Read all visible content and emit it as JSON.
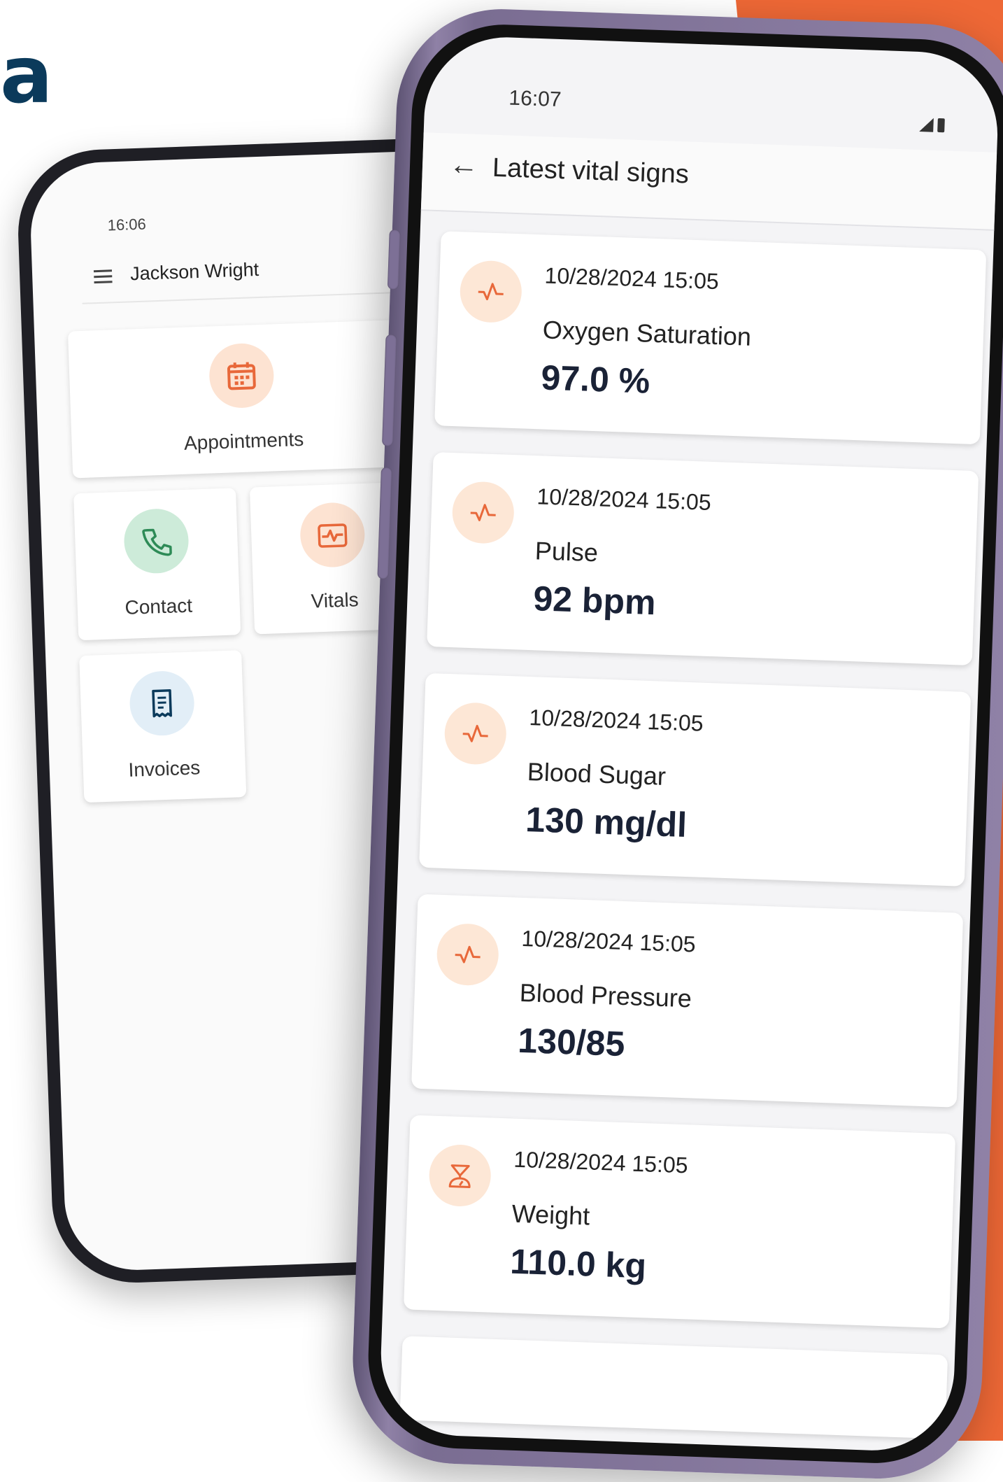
{
  "brand": {
    "letter": "a",
    "text_color": "#0b3a5b",
    "accent_color": "#ee6836"
  },
  "back_phone": {
    "status_time": "16:06",
    "user_name": "Jackson Wright",
    "tiles": [
      {
        "label": "Appointments",
        "icon": "calendar-icon",
        "color": "#e8683a"
      },
      {
        "label": "Contact",
        "icon": "phone-icon",
        "color": "#2e8b57"
      },
      {
        "label": "Vitals",
        "icon": "vitals-icon",
        "color": "#e8683a"
      },
      {
        "label": "Invoices",
        "icon": "invoice-icon",
        "color": "#0b3a5b"
      }
    ]
  },
  "front_phone": {
    "status_time": "16:07",
    "title": "Latest vital signs",
    "vitals": [
      {
        "date": "10/28/2024 15:05",
        "name": "Oxygen Saturation",
        "value": "97.0 %",
        "icon": "pulse-icon"
      },
      {
        "date": "10/28/2024 15:05",
        "name": "Pulse",
        "value": "92 bpm",
        "icon": "pulse-icon"
      },
      {
        "date": "10/28/2024 15:05",
        "name": "Blood Sugar",
        "value": "130 mg/dl",
        "icon": "pulse-icon"
      },
      {
        "date": "10/28/2024 15:05",
        "name": "Blood Pressure",
        "value": "130/85",
        "icon": "pulse-icon"
      },
      {
        "date": "10/28/2024 15:05",
        "name": "Weight",
        "value": "110.0 kg",
        "icon": "scale-icon"
      }
    ]
  }
}
